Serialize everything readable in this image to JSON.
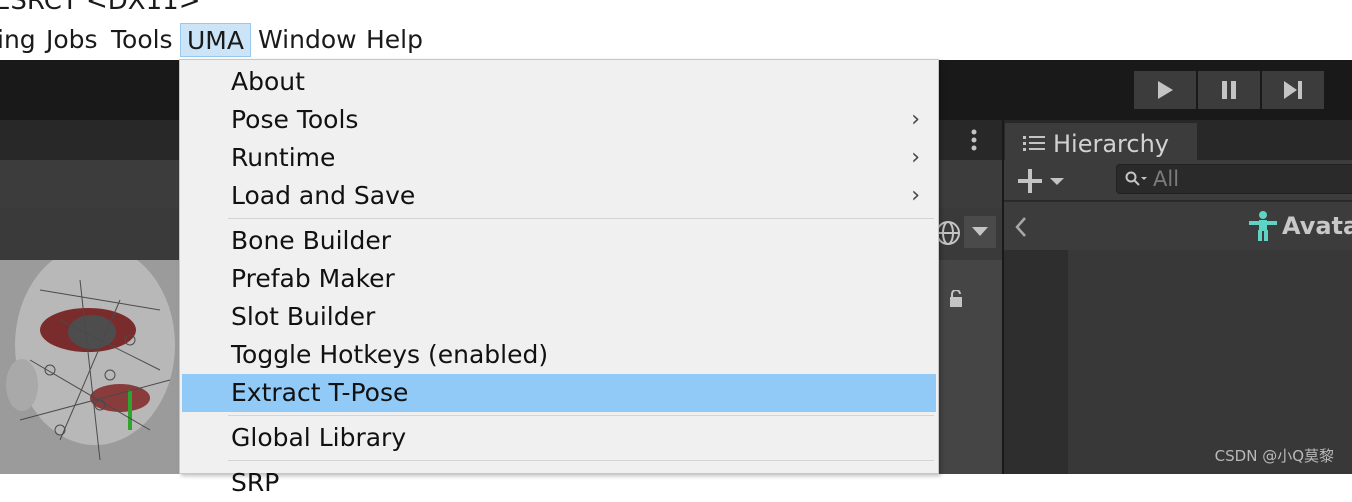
{
  "titlebar": {
    "text": "ESRCT <DX11>"
  },
  "menubar": {
    "items": [
      {
        "label": "ing"
      },
      {
        "label": "Jobs"
      },
      {
        "label": "Tools"
      },
      {
        "label": "UMA"
      },
      {
        "label": "Window"
      },
      {
        "label": "Help"
      }
    ],
    "active": "UMA"
  },
  "dropdown": {
    "items": [
      {
        "label": "About",
        "submenu": false
      },
      {
        "label": "Pose Tools",
        "submenu": true
      },
      {
        "label": "Runtime",
        "submenu": true
      },
      {
        "label": "Load and Save",
        "submenu": true
      },
      {
        "label": "Bone Builder",
        "submenu": false
      },
      {
        "label": "Prefab Maker",
        "submenu": false
      },
      {
        "label": "Slot Builder",
        "submenu": false
      },
      {
        "label": "Toggle Hotkeys (enabled)",
        "submenu": false
      },
      {
        "label": "Extract T-Pose",
        "submenu": false,
        "highlighted": true
      },
      {
        "label": "Global Library",
        "submenu": false
      },
      {
        "label": "SRP",
        "submenu": false
      }
    ],
    "submenu_arrow": "›",
    "highlight_color": "#91c9f7"
  },
  "hierarchy": {
    "tab_label": "Hierarchy",
    "search_placeholder": "All",
    "header_label": "Avata",
    "icons": [
      "list-icon",
      "plus-icon",
      "dropdown-arrow-icon",
      "search-icon",
      "back-arrow-icon",
      "avatar-figure-icon"
    ]
  },
  "toolbar": {
    "icons": [
      "play-icon",
      "pause-icon",
      "step-icon"
    ]
  },
  "watermark": "CSDN @小Q莫黎"
}
